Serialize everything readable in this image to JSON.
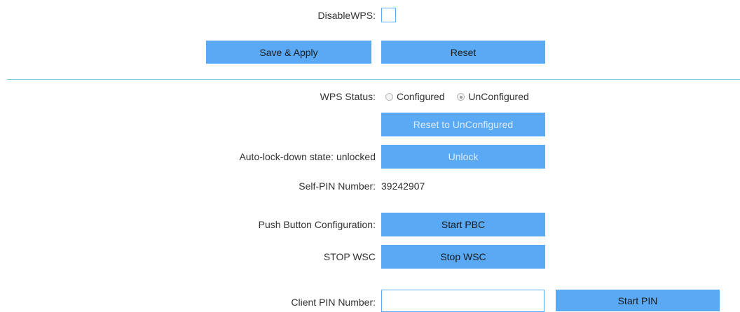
{
  "wps": {
    "disable_label": "DisableWPS:",
    "save_label": "Save & Apply",
    "reset_label": "Reset",
    "status_label": "WPS Status:",
    "status_options": [
      "Configured",
      "UnConfigured"
    ],
    "status_selected": "UnConfigured",
    "reset_unconfigured_label": "Reset to UnConfigured",
    "autolock_label": "Auto-lock-down state: unlocked",
    "unlock_label": "Unlock",
    "self_pin_label": "Self-PIN Number:",
    "self_pin_value": "39242907",
    "pbc_label": "Push Button Configuration:",
    "start_pbc_label": "Start PBC",
    "stop_wsc_label": "STOP WSC",
    "stop_wsc_button": "Stop WSC",
    "client_pin_label": "Client PIN Number:",
    "client_pin_value": "",
    "start_pin_label": "Start PIN"
  },
  "colors": {
    "accent": "#5aa9f5",
    "divider": "#7fbfe0",
    "disabled_text": "#dcecfc"
  }
}
